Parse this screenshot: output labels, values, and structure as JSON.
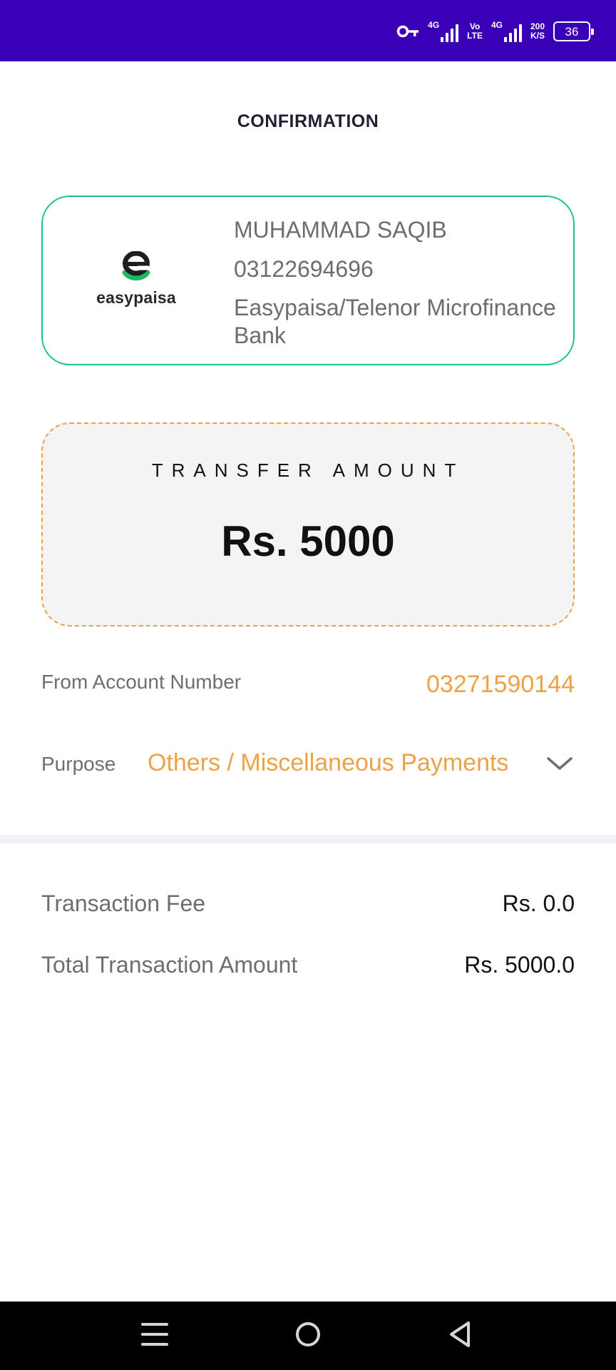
{
  "status_bar": {
    "network_1": "4G",
    "network_2_top": "Vo",
    "network_2_bottom": "LTE",
    "network_3": "4G",
    "speed_value": "200",
    "speed_unit": "K/S",
    "battery": "36",
    "background": "#3a00b8"
  },
  "page": {
    "title": "CONFIRMATION"
  },
  "recipient": {
    "logo_text": "easypaisa",
    "name": "MUHAMMAD SAQIB",
    "account": "03122694696",
    "bank": "Easypaisa/Telenor Microfinance Bank",
    "border_color": "#1fbf95"
  },
  "transfer": {
    "label": "TRANSFER AMOUNT",
    "amount": "Rs. 5000",
    "accent_color": "#f0a045"
  },
  "details": {
    "from_label": "From Account Number",
    "from_value": "03271590144",
    "purpose_label": "Purpose",
    "purpose_value": "Others / Miscellaneous Payments"
  },
  "summary": {
    "fee_label": "Transaction Fee",
    "fee_value": "Rs. 0.0",
    "total_label": "Total Transaction Amount",
    "total_value": "Rs. 5000.0"
  },
  "navigation": {
    "icons": [
      "menu-icon",
      "home-icon",
      "back-icon"
    ]
  }
}
